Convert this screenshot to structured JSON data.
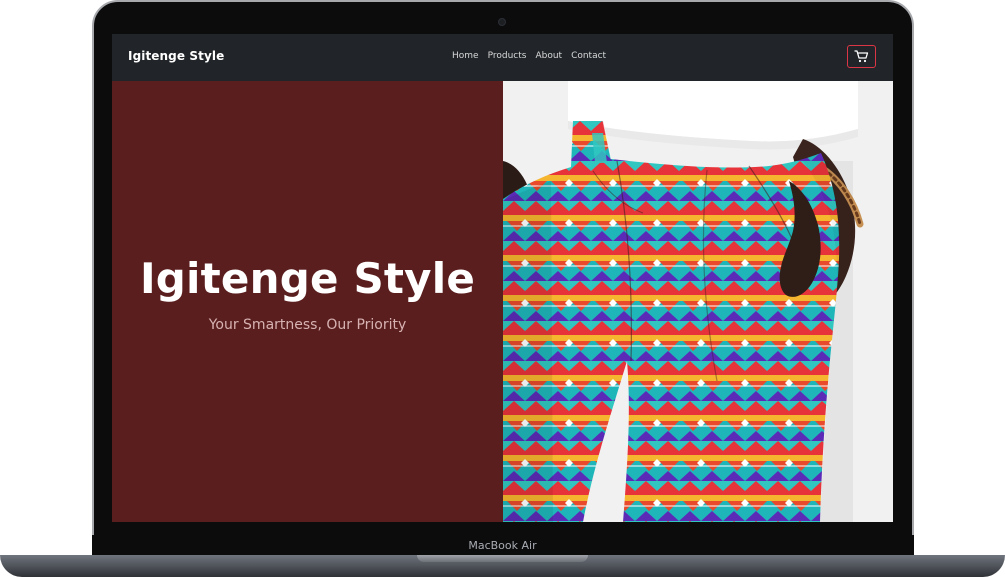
{
  "device": {
    "label": "MacBook Air"
  },
  "navbar": {
    "brand": "Igitenge Style",
    "links": [
      "Home",
      "Products",
      "About",
      "Contact"
    ],
    "cart_icon": "cart-icon",
    "colors": {
      "background": "#212529",
      "cart_border": "#dc3545"
    }
  },
  "hero": {
    "title": "Igitenge Style",
    "subtitle": "Your Smartness, Our Priority",
    "left_panel_color": "#5b1e1e"
  }
}
